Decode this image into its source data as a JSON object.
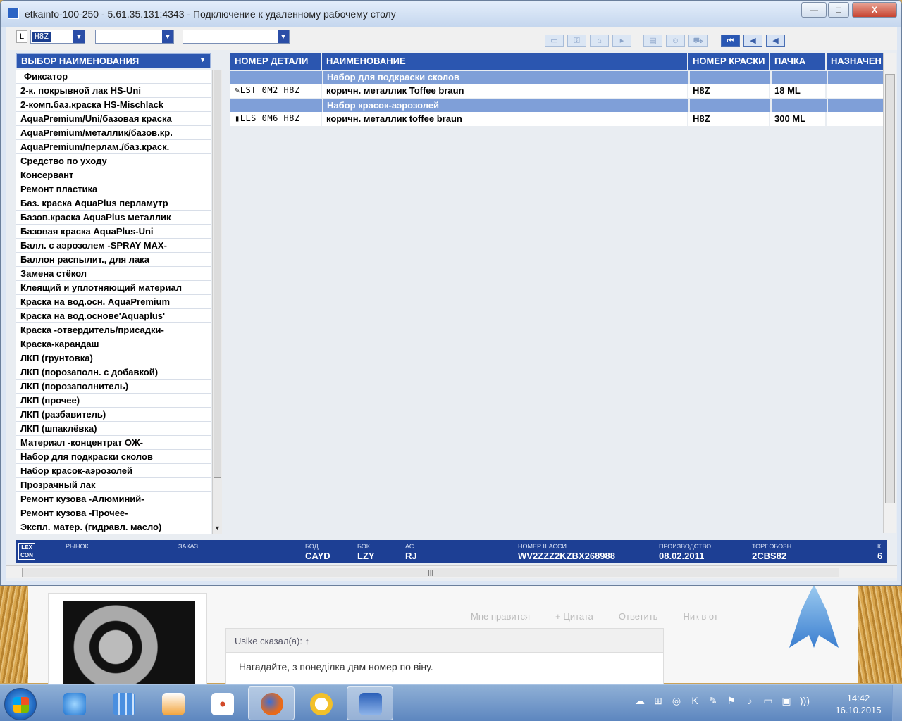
{
  "window": {
    "title": "etkainfo-100-250 - 5.61.35.131:4343 - Подключение к удаленному рабочему столу",
    "buttons": {
      "minimize": "—",
      "maximize": "□",
      "close": "X"
    }
  },
  "toolbar": {
    "l_label": "L",
    "combo1_value": "H8Z",
    "combo2_value": "",
    "combo3_value": ""
  },
  "left_panel": {
    "header": "ВЫБОР НАИМЕНОВАНИЯ",
    "items": [
      "Фиксатор",
      "2-к. покрывной лак HS-Uni",
      "2-комп.баз.краска HS-Mischlack",
      "AquaPremium/Uni/базовая краска",
      "AquaPremium/металлик/базов.кр.",
      "AquaPremium/перлам./баз.краск.",
      "Средство по уходу",
      "Консервант",
      "Ремонт пластика",
      "Баз. краска AquaPlus перламутр",
      "Базов.краска AquaPlus металлик",
      "Базовая краска AquaPlus-Uni",
      "Балл. с аэрозолем  -SPRAY MAX-",
      "Баллон распылит., для лака",
      "Замена стёкол",
      "Клеящий и уплотняющий материал",
      "Краска на вод.осн. AquaPremium",
      "Краска на вод.основе'Aquaplus'",
      "Краска -отвердитель/присадки-",
      "Краска-карандаш",
      "ЛКП (грунтовка)",
      "ЛКП (порозаполн. с добавкой)",
      "ЛКП (порозаполнитель)",
      "ЛКП (прочее)",
      "ЛКП (разбавитель)",
      "ЛКП (шпаклёвка)",
      "Материал -концентрат ОЖ-",
      "Набор для подкраски сколов",
      "Набор красок-аэрозолей",
      "Прозрачный лак",
      "Ремонт кузова -Алюминий-",
      "Ремонт кузова -Прочее-",
      "Экспл. матер. (гидравл. масло)"
    ]
  },
  "table": {
    "columns": [
      "НОМЕР ДЕТАЛИ",
      "НАИМЕНОВАНИЕ",
      "НОМЕР КРАСКИ",
      "ПАЧКА",
      "НАЗНАЧЕН"
    ],
    "groups": [
      {
        "title": "Набор для подкраски сколов",
        "rows": [
          {
            "part": "LST  0M2  H8Z",
            "name": "коричн. металлик Toffee braun",
            "paint": "H8Z",
            "pack": "18 ML",
            "purpose": ""
          }
        ]
      },
      {
        "title": "Набор красок-аэрозолей",
        "rows": [
          {
            "part": "LLS  0M6  H8Z",
            "name": "коричн. металлик toffee braun",
            "paint": "H8Z",
            "pack": "300 ML",
            "purpose": ""
          }
        ]
      }
    ]
  },
  "status_bar": {
    "logo": "LEX CON",
    "fields": [
      {
        "label": "РЫНОК",
        "value": ""
      },
      {
        "label": "ЗАКАЗ",
        "value": ""
      },
      {
        "label": "БОД",
        "value": "CAYD"
      },
      {
        "label": "БОК",
        "value": "LZY"
      },
      {
        "label": "АС",
        "value": "RJ"
      },
      {
        "label": "НОМЕР ШАССИ",
        "value": "WV2ZZZ2KZBX268988"
      },
      {
        "label": "ПРОИЗВОДСТВО",
        "value": "08.02.2011"
      },
      {
        "label": "ТОРГ.ОБОЗН.",
        "value": "2CBS82"
      },
      {
        "label": "К",
        "value": "6"
      }
    ]
  },
  "background_page": {
    "actions": [
      "Мне нравится",
      "+ Цитата",
      "Ответить",
      "Ник в от"
    ],
    "quote_header": "Usike сказал(а): ↑",
    "quote_body": "Нагадайте, з понеділка дам номер по віну."
  },
  "taskbar": {
    "clock_time": "14:42",
    "clock_date": "16.10.2015"
  }
}
